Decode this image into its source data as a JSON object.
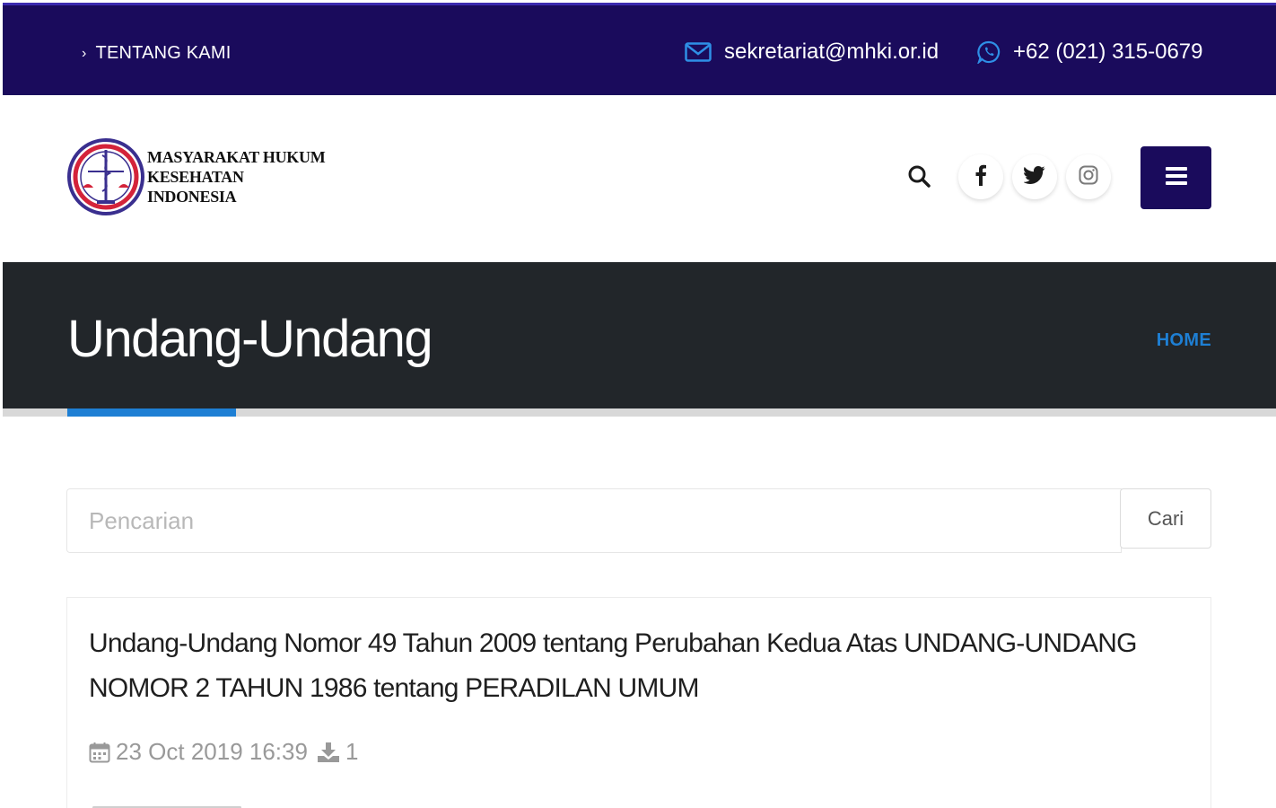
{
  "topbar": {
    "about_label": "TENTANG KAMI",
    "email": "sekretariat@mhki.or.id",
    "phone": "+62 (021) 315-0679"
  },
  "header": {
    "brand_line1": "MASYARAKAT HUKUM",
    "brand_line2": "KESEHATAN INDONESIA",
    "icons": [
      "search-icon",
      "facebook-icon",
      "twitter-icon",
      "instagram-icon",
      "menu-icon"
    ]
  },
  "title_band": {
    "title": "Undang-Undang",
    "breadcrumb": "HOME"
  },
  "search": {
    "placeholder": "Pencarian",
    "value": "",
    "button_label": "Cari"
  },
  "results": [
    {
      "title": "Undang-Undang Nomor 49 Tahun 2009 tentang Perubahan Kedua Atas UNDANG-UNDANG NOMOR 2 TAHUN 1986 tentang PERADILAN UMUM",
      "date": "23 Oct 2019 16:39",
      "downloads": "1"
    }
  ],
  "colors": {
    "topbar_bg": "#1a0b5c",
    "title_band_bg": "#22262a",
    "accent_blue": "#1e7fd4"
  }
}
